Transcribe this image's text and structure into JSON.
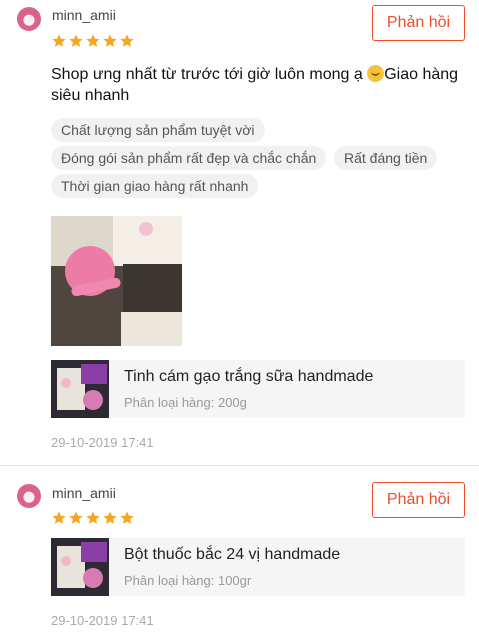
{
  "reviews": [
    {
      "username": "minn_amii",
      "rating": 5,
      "reply_label": "Phản hồi",
      "comment_line1": "Shop ưng nhất từ trước tới giờ luôn mong ạ",
      "emoji": "smiling-tear-emoji",
      "comment_line1_tail": "Giao hàng",
      "comment_line2": "siêu nhanh",
      "tags": [
        "Chất lượng sản phẩm tuyệt vời",
        "Đóng gói sản phẩm rất đẹp và chắc chắn",
        "Rất đáng tiền",
        "Thời gian giao hàng rất nhanh"
      ],
      "product_name": "Tinh cám gạo trắng sữa handmade",
      "variation": "Phân loại hàng: 200g",
      "date": "29-10-2019 17:41"
    },
    {
      "username": "minn_amii",
      "rating": 5,
      "reply_label": "Phản hồi",
      "product_name": "Bột thuốc bắc 24 vị handmade",
      "variation": "Phân loại hàng: 100gr",
      "date": "29-10-2019 17:41"
    }
  ],
  "colors": {
    "accent": "#ee4d2d",
    "star": "#f5a623"
  }
}
